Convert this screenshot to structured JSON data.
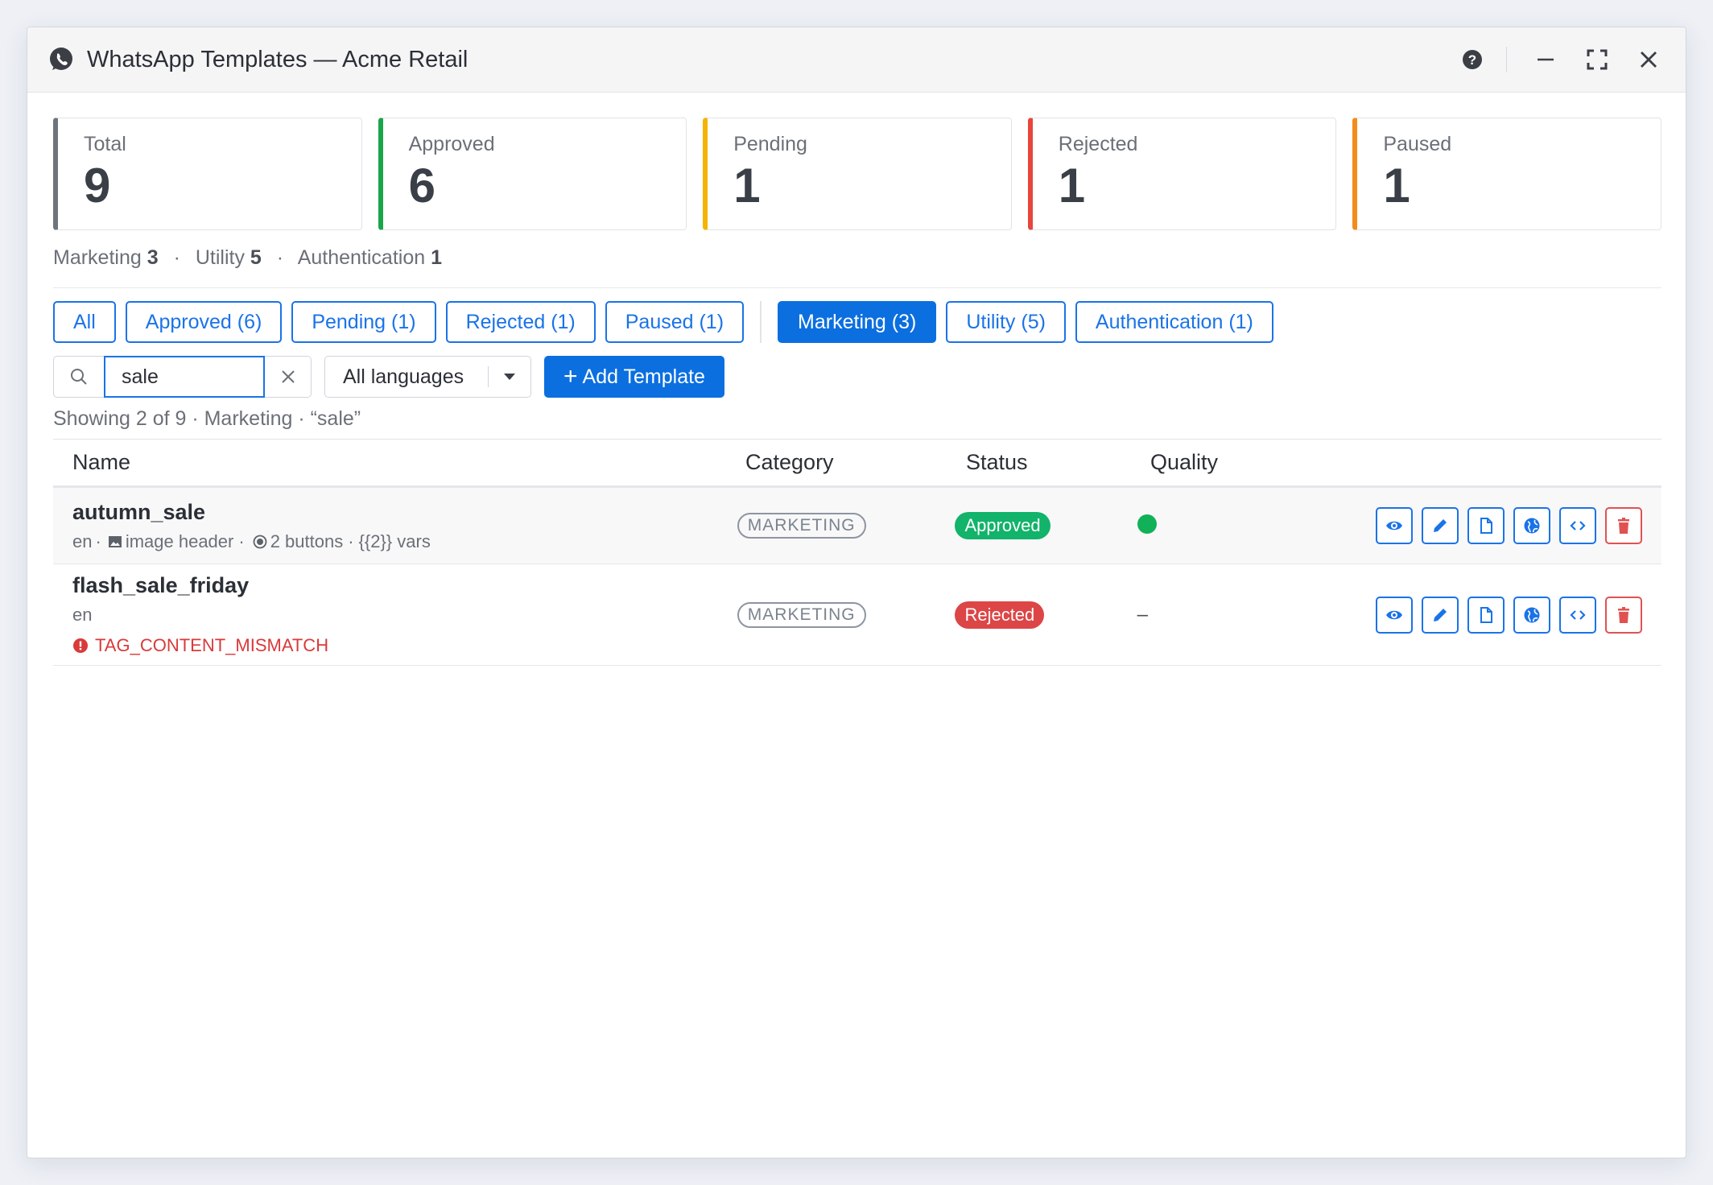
{
  "window": {
    "title": "WhatsApp Templates — Acme Retail",
    "app_icon": "whatsapp-icon",
    "controls": [
      "help-icon",
      "minimize-icon",
      "maximize-icon",
      "close-icon"
    ]
  },
  "stats": [
    {
      "label": "Total",
      "value": "9",
      "color": "#6c757d"
    },
    {
      "label": "Approved",
      "value": "6",
      "color": "#1aa64a"
    },
    {
      "label": "Pending",
      "value": "1",
      "color": "#f4b400"
    },
    {
      "label": "Rejected",
      "value": "1",
      "color": "#e8453c"
    },
    {
      "label": "Paused",
      "value": "1",
      "color": "#f28c1b"
    }
  ],
  "category_summary": [
    {
      "label": "Marketing",
      "count": "3"
    },
    {
      "label": "Utility",
      "count": "5"
    },
    {
      "label": "Authentication",
      "count": "1"
    }
  ],
  "category_summary_separator": "·",
  "status_filters": [
    "All",
    "Approved (6)",
    "Pending (1)",
    "Rejected (1)",
    "Paused (1)"
  ],
  "category_filters": [
    "Marketing (3)",
    "Utility (5)",
    "Authentication (1)"
  ],
  "active_filter": "Marketing (3)",
  "search": {
    "value": "sale"
  },
  "language_select": {
    "selected": "All languages"
  },
  "add_button": {
    "plus": "+",
    "label": "Add Template"
  },
  "showing_text": "Showing 2 of 9 · Marketing · “sale”",
  "table": {
    "headers": {
      "name": "Name",
      "category": "Category",
      "status": "Status",
      "quality": "Quality"
    },
    "rows": [
      {
        "name": "autumn_sale",
        "lang": "en",
        "sep": "·",
        "header": "image header",
        "buttons": "2 buttons",
        "vars": "{{2}} vars",
        "category": "MARKETING",
        "status": "Approved",
        "quality": "green"
      },
      {
        "name": "flash_sale_friday",
        "lang": "en",
        "error": "TAG_CONTENT_MISMATCH",
        "category": "MARKETING",
        "status": "Rejected",
        "quality": "–"
      }
    ]
  },
  "row_actions": [
    "preview-icon",
    "edit-icon",
    "duplicate-icon",
    "translate-icon",
    "code-icon",
    "delete-icon"
  ],
  "colors": {
    "accent": "#0b6fe0",
    "approved": "#12b36a",
    "rejected": "#dc4646",
    "quality_green": "#11b157"
  }
}
